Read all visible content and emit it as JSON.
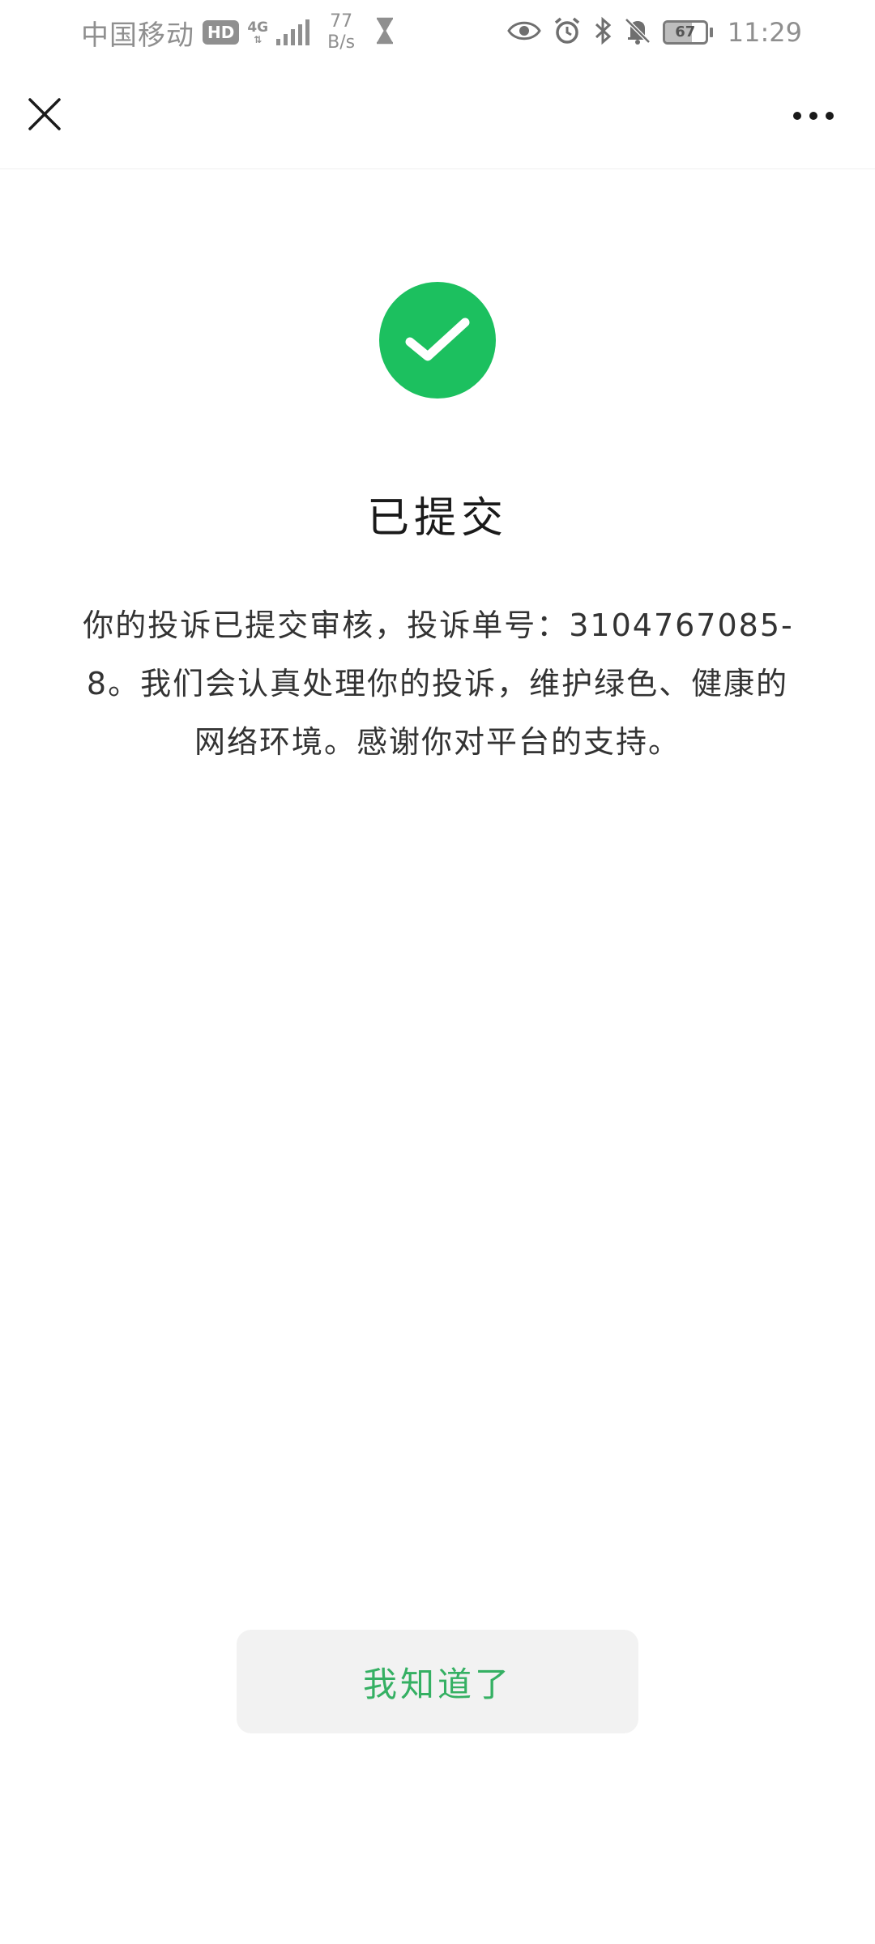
{
  "status_bar": {
    "carrier": "中国移动",
    "hd_badge": "HD",
    "network_type": "4G",
    "data_speed_value": "77",
    "data_speed_unit": "B/s",
    "battery_level": "67",
    "time": "11:29",
    "icons": [
      "hourglass-icon",
      "eye-icon",
      "alarm-icon",
      "bluetooth-icon",
      "bell-muted-icon",
      "battery-icon"
    ]
  },
  "nav": {
    "close_icon": "close-icon",
    "more_icon": "more-dots-icon"
  },
  "result": {
    "status_icon": "success-check-icon",
    "status_color": "#1cc05f",
    "title": "已提交",
    "message": "你的投诉已提交审核，投诉单号：3104767085­8。我们会认真处理你的投诉，维护绿色、健康的网络环境。感谢你对平台的支持。"
  },
  "actions": {
    "confirm_label": "我知道了",
    "confirm_color": "#35b063"
  }
}
